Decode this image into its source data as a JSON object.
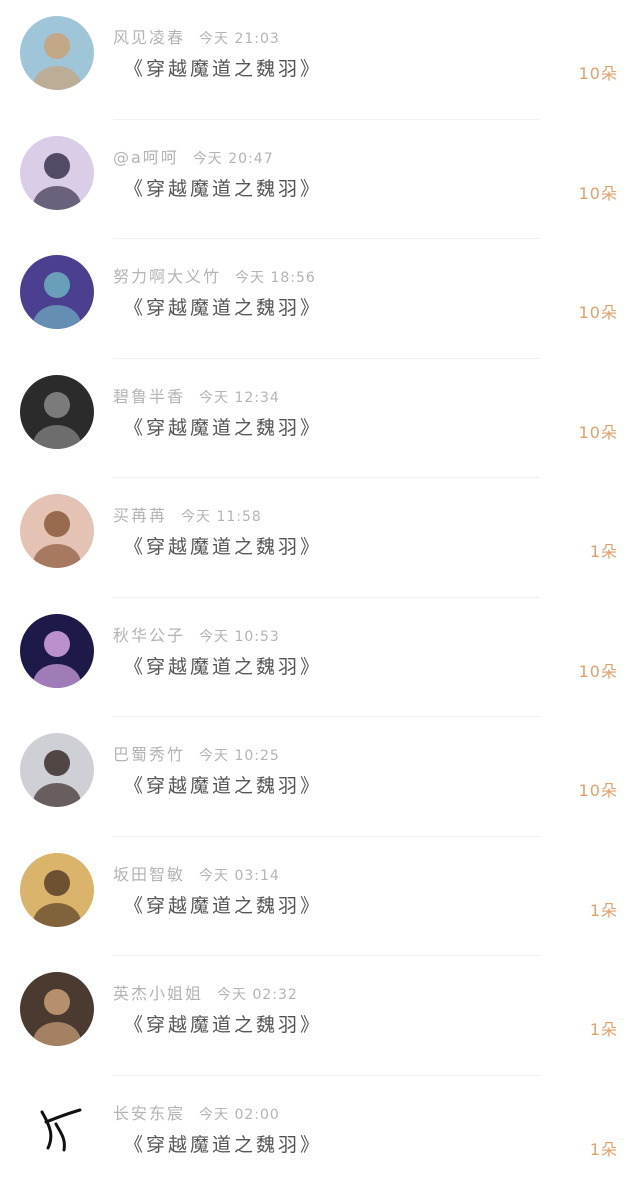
{
  "list": {
    "items": [
      {
        "user": "风见凌春",
        "time": "今天 21:03",
        "title": "《穿越魔道之魏羽》",
        "gift": "10朵",
        "avatar_color": "#9fc5d8",
        "avatar_accent": "#c9a27a"
      },
      {
        "user": "@a呵呵",
        "time": "今天 20:47",
        "title": "《穿越魔道之魏羽》",
        "gift": "10朵",
        "avatar_color": "#d9cde8",
        "avatar_accent": "#3b3350"
      },
      {
        "user": "努力啊大义竹",
        "time": "今天 18:56",
        "title": "《穿越魔道之魏羽》",
        "gift": "10朵",
        "avatar_color": "#4b3f8f",
        "avatar_accent": "#6fb0c0"
      },
      {
        "user": "碧鲁半香",
        "time": "今天 12:34",
        "title": "《穿越魔道之魏羽》",
        "gift": "10朵",
        "avatar_color": "#2b2b2b",
        "avatar_accent": "#8a8a8a"
      },
      {
        "user": "买苒苒",
        "time": "今天 11:58",
        "title": "《穿越魔道之魏羽》",
        "gift": "1朵",
        "avatar_color": "#e4c2b4",
        "avatar_accent": "#8b5a3c"
      },
      {
        "user": "秋华公子",
        "time": "今天 10:53",
        "title": "《穿越魔道之魏羽》",
        "gift": "10朵",
        "avatar_color": "#1d1a4a",
        "avatar_accent": "#d7a6e6"
      },
      {
        "user": "巴蜀秀竹",
        "time": "今天 10:25",
        "title": "《穿越魔道之魏羽》",
        "gift": "10朵",
        "avatar_color": "#cfcfd6",
        "avatar_accent": "#3a2e2a"
      },
      {
        "user": "坂田智敏",
        "time": "今天 03:14",
        "title": "《穿越魔道之魏羽》",
        "gift": "1朵",
        "avatar_color": "#d9b46a",
        "avatar_accent": "#5a4028"
      },
      {
        "user": "英杰小姐姐",
        "time": "今天 02:32",
        "title": "《穿越魔道之魏羽》",
        "gift": "1朵",
        "avatar_color": "#4a3a30",
        "avatar_accent": "#c9a078"
      },
      {
        "user": "长安东宸",
        "time": "今天 02:00",
        "title": "《穿越魔道之魏羽》",
        "gift": "1朵",
        "avatar_color": "#ffffff",
        "avatar_accent": "#111111"
      }
    ]
  }
}
